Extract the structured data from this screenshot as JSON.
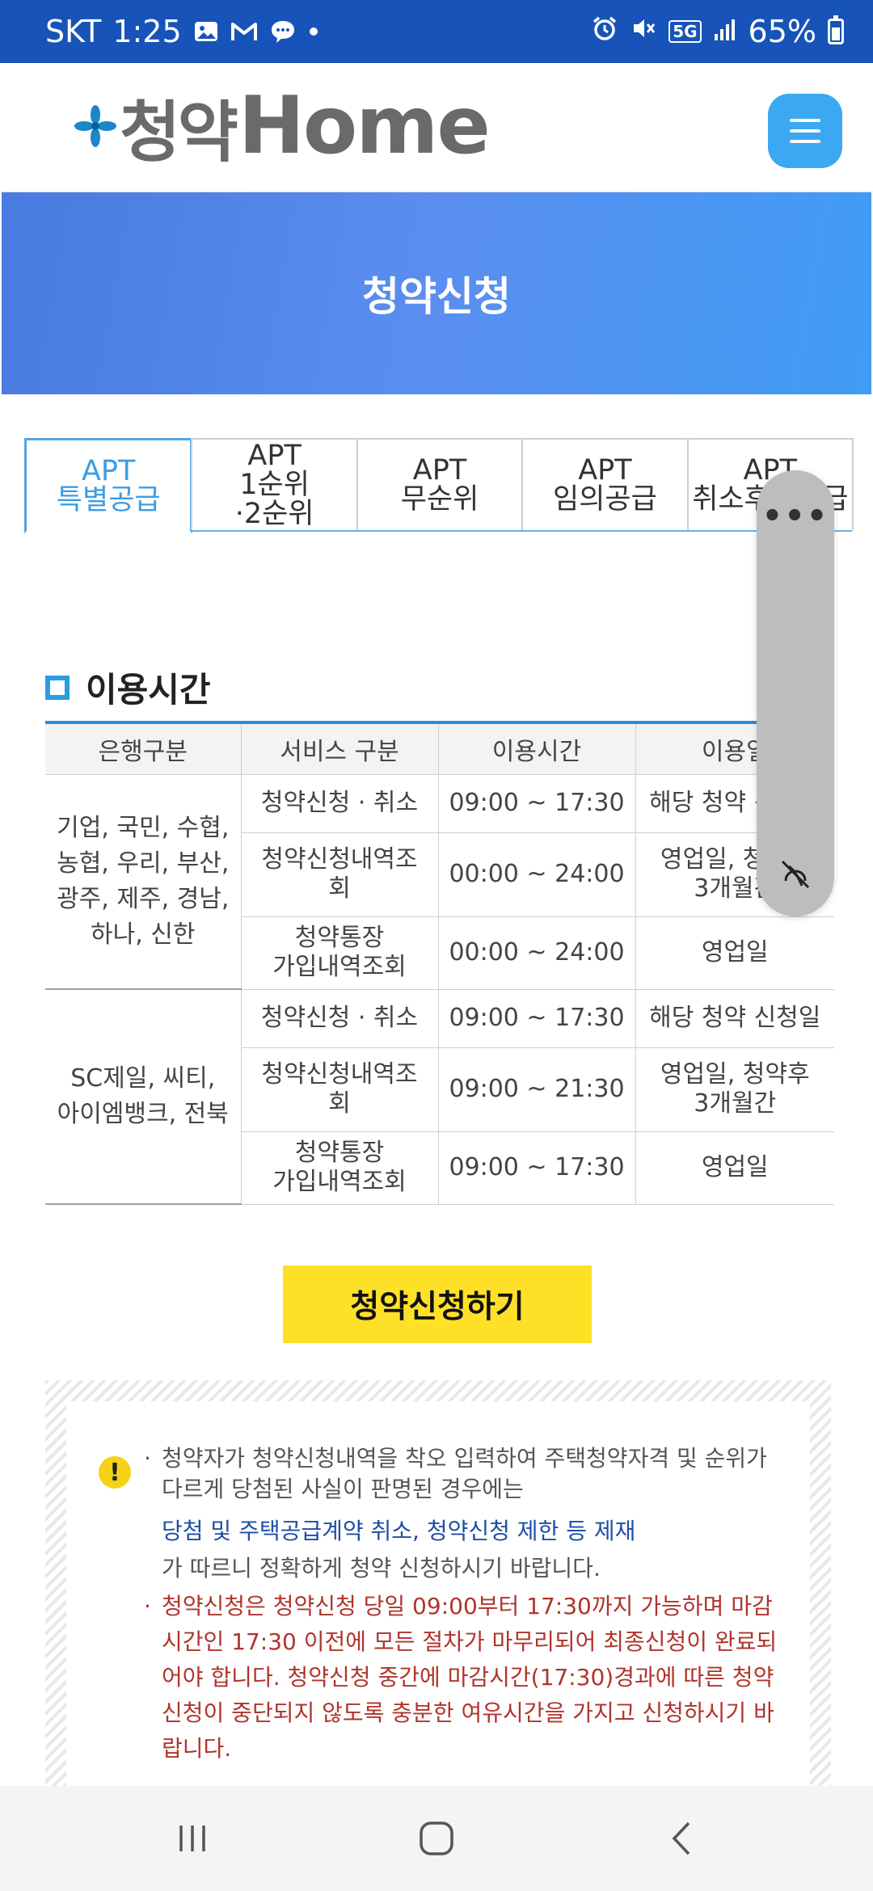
{
  "status_bar": {
    "carrier": "SKT",
    "time": "1:25",
    "network": "5G",
    "battery": "65%"
  },
  "header": {
    "logo_kor": "청약",
    "logo_eng": "Home"
  },
  "banner": {
    "title": "청약신청"
  },
  "tabs": [
    {
      "line1": "APT",
      "line2": "특별공급",
      "line3": "",
      "active": true
    },
    {
      "line1": "APT",
      "line2": "1순위",
      "line3": "·2순위",
      "active": false
    },
    {
      "line1": "APT",
      "line2": "무순위",
      "line3": "",
      "active": false
    },
    {
      "line1": "APT",
      "line2": "임의공급",
      "line3": "",
      "active": false
    },
    {
      "line1": "APT",
      "line2": "취소후재공급",
      "line3": "",
      "active": false
    }
  ],
  "section": {
    "title": "이용시간"
  },
  "table": {
    "headers": [
      "은행구분",
      "서비스 구분",
      "이용시간",
      "이용일"
    ],
    "groups": [
      {
        "bank": "기업, 국민, 수협,\n농협, 우리, 부산,\n광주, 제주, 경남,\n하나, 신한",
        "rows": [
          {
            "service": "청약신청 · 취소",
            "time": "09:00 ~ 17:30",
            "days": "해당 청약 신청일"
          },
          {
            "service": "청약신청내역조\n회",
            "time": "00:00 ~ 24:00",
            "days": "영업일, 청약후\n3개월간"
          },
          {
            "service": "청약통장\n가입내역조회",
            "time": "00:00 ~ 24:00",
            "days": "영업일"
          }
        ]
      },
      {
        "bank": "SC제일, 씨티,\n아이엠뱅크, 전북",
        "rows": [
          {
            "service": "청약신청 · 취소",
            "time": "09:00 ~ 17:30",
            "days": "해당 청약 신청일"
          },
          {
            "service": "청약신청내역조\n회",
            "time": "09:00 ~ 21:30",
            "days": "영업일, 청약후\n3개월간"
          },
          {
            "service": "청약통장\n가입내역조회",
            "time": "09:00 ~ 17:30",
            "days": "영업일"
          }
        ]
      }
    ]
  },
  "cta": {
    "label": "청약신청하기"
  },
  "notice": {
    "item1_text": "청약자가 청약신청내역을 착오 입력하여 주택청약자격 및 순위가 다르게 당첨된 사실이 판명된 경우에는",
    "item1_link": "당첨 및 주택공급계약 취소, 청약신청 제한 등 제재",
    "item1_end": "가 따르니 정확하게 청약 신청하시기 바랍니다.",
    "item2_text": "청약신청은 청약신청 당일 09:00부터 17:30까지 가능하며 마감시간인 17:30 이전에 모든 절차가 마무리되어 최종신청이 완료되어야 합니다. 청약신청 중간에 마감시간(17:30)경과에 따른 청약신청이 중단되지 않도록 충분한 여유시간을 가지고 신청하시기 바랍니다."
  },
  "edge_panel": {
    "dots": "•••"
  },
  "colors": {
    "status_bar": "#1753b8",
    "accent_blue": "#2d9be0",
    "cta_yellow": "#fee127",
    "warning_red": "#b0342c",
    "link_blue": "#1d4ea8"
  }
}
